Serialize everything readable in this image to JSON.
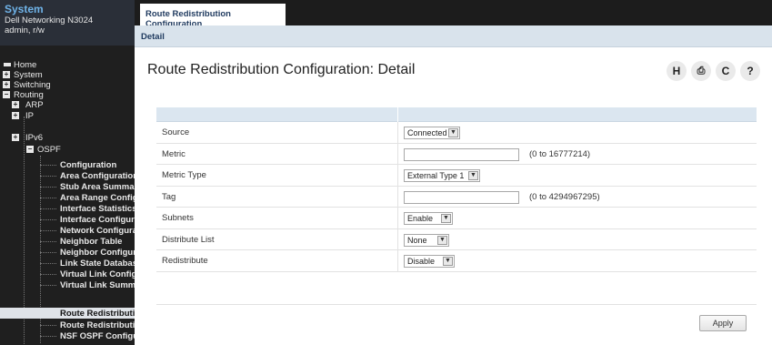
{
  "system": {
    "title": "System",
    "device": "Dell Networking N3024",
    "user": "admin, r/w"
  },
  "nav": {
    "home": "Home",
    "system": "System",
    "switching": "Switching",
    "routing": "Routing",
    "arp": "ARP",
    "ip": "IP",
    "ipv6": "IPv6",
    "ospf": "OSPF",
    "ospf_items": [
      "Configuration",
      "Area Configuration",
      "Stub Area Summary",
      "Area Range Configuration",
      "Interface Statistics",
      "Interface Configuration",
      "Network Configuration",
      "Neighbor Table",
      "Neighbor Configuration",
      "Link State Database",
      "Virtual Link Configuration",
      "Virtual Link Summary",
      "Route Redistribution",
      "Route Redistribution",
      "NSF OSPF Configuration"
    ]
  },
  "tabs": {
    "active": "Route Redistribution Configuration",
    "sub": "Detail"
  },
  "page": {
    "title": "Route Redistribution Configuration: Detail"
  },
  "toolbar_icons": [
    "help-H-icon",
    "print-icon",
    "refresh-icon",
    "question-icon"
  ],
  "toolbar_glyphs": {
    "h": "H",
    "print": "⎙",
    "refresh": "C",
    "help": "?"
  },
  "form": {
    "source": {
      "label": "Source",
      "value": "Connected"
    },
    "metric": {
      "label": "Metric",
      "value": "",
      "hint": "(0 to 16777214)"
    },
    "metric_type": {
      "label": "Metric Type",
      "value": "External Type 1"
    },
    "tag": {
      "label": "Tag",
      "value": "",
      "hint": "(0 to 4294967295)"
    },
    "subnets": {
      "label": "Subnets",
      "value": "Enable"
    },
    "distribute_list": {
      "label": "Distribute List",
      "value": "None"
    },
    "redistribute": {
      "label": "Redistribute",
      "value": "Disable"
    }
  },
  "buttons": {
    "apply": "Apply"
  },
  "colors": {
    "sidebar_bg": "#1f1f1f",
    "system_title": "#6fb3e8",
    "subbar_bg": "#d9e3ec"
  }
}
